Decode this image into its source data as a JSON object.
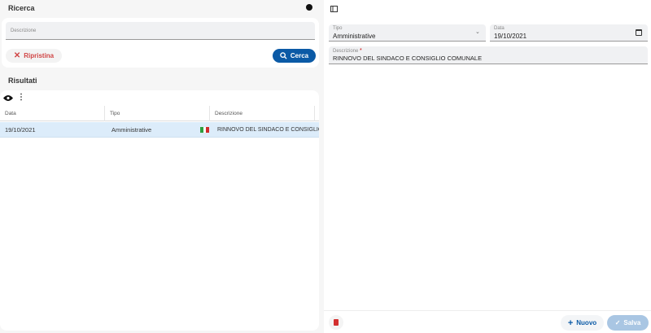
{
  "search": {
    "title": "Ricerca",
    "description_placeholder": "Descrizione",
    "reset_label": "Ripristina",
    "search_label": "Cerca"
  },
  "results": {
    "title": "Risultati",
    "columns": [
      "Data",
      "Tipo",
      "Descrizione"
    ],
    "rows": [
      {
        "data": "19/10/2021",
        "tipo": "Amministrative",
        "descrizione": "RINNOVO DEL SINDACO E CONSIGLIO COMUNALE"
      }
    ]
  },
  "detail": {
    "tipo_label": "Tipo",
    "tipo_value": "Amministrative",
    "data_label": "Data",
    "data_value": "19/10/2021",
    "descrizione_label": "Descrizione",
    "required_mark": "*",
    "descrizione_value": "RINNOVO DEL SINDACO E CONSIGLIO COMUNALE",
    "new_label": "Nuovo",
    "save_label": "Salva"
  },
  "colors": {
    "primary": "#0b5aa6",
    "danger": "#d32f2f",
    "selected_row": "#dcecfa",
    "save_disabled": "#a9c6e3"
  }
}
